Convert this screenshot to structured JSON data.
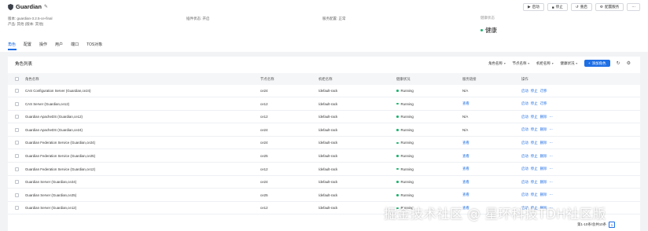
{
  "service": {
    "name": "Guardian",
    "version_label": "版本: guardian-3.2.5-ce-final",
    "product_label": "产品: 其他 (版本: 其他)",
    "plugin_status_label": "插件状态: 开启",
    "config_status_label": "服务配置: 正常",
    "health_label": "健康状态",
    "health_value": "健康"
  },
  "actions": [
    {
      "icon": "▶",
      "label": "启动",
      "name": "start"
    },
    {
      "icon": "■",
      "label": "停止",
      "name": "stop"
    },
    {
      "icon": "↺",
      "label": "重启",
      "name": "restart"
    },
    {
      "icon": "⚙",
      "label": "配置服务",
      "name": "configure"
    },
    {
      "icon": "⋯",
      "label": "",
      "name": "more"
    }
  ],
  "tabs": [
    "角色",
    "配置",
    "操作",
    "用户",
    "端口",
    "TOS对象"
  ],
  "roles": {
    "title": "角色列表",
    "filters": [
      "角色名称",
      "节点名称",
      "机柜名称",
      "健康状况"
    ],
    "add_label": "添加角色",
    "columns": [
      "角色名称",
      "节点名称",
      "机柜名称",
      "健康状况",
      "服务链接",
      "操作"
    ],
    "rows": [
      {
        "name": "CAS Configuration Server (Guardian,ce24)",
        "node": "ce24",
        "rack": "/default-rack",
        "health": "Running",
        "link": "N/A",
        "link_is_link": false,
        "ops": [
          "启动",
          "停止",
          "迁移"
        ],
        "more": ""
      },
      {
        "name": "CAS Server (Guardian,ce12)",
        "node": "ce12",
        "rack": "/default-rack",
        "health": "Running",
        "link": "查看",
        "link_is_link": true,
        "ops": [
          "启动",
          "停止",
          "迁移"
        ],
        "more": ""
      },
      {
        "name": "Guardian ApacheDS (Guardian,ce12)",
        "node": "ce12",
        "rack": "/default-rack",
        "health": "Running",
        "link": "N/A",
        "link_is_link": false,
        "ops": [
          "启动",
          "停止",
          "删除"
        ],
        "more": "⋯"
      },
      {
        "name": "Guardian ApacheDS (Guardian,ce24)",
        "node": "ce24",
        "rack": "/default-rack",
        "health": "Running",
        "link": "N/A",
        "link_is_link": false,
        "ops": [
          "启动",
          "停止",
          "删除"
        ],
        "more": "⋯"
      },
      {
        "name": "Guardian Federation Service (Guardian,ce24)",
        "node": "ce24",
        "rack": "/default-rack",
        "health": "Running",
        "link": "查看",
        "link_is_link": true,
        "ops": [
          "启动",
          "停止",
          "删除"
        ],
        "more": "⋯"
      },
      {
        "name": "Guardian Federation Service (Guardian,ce25)",
        "node": "ce25",
        "rack": "/default-rack",
        "health": "Running",
        "link": "查看",
        "link_is_link": true,
        "ops": [
          "启动",
          "停止",
          "删除"
        ],
        "more": "⋯"
      },
      {
        "name": "Guardian Federation Service (Guardian,ce12)",
        "node": "ce12",
        "rack": "/default-rack",
        "health": "Running",
        "link": "查看",
        "link_is_link": true,
        "ops": [
          "启动",
          "停止",
          "删除"
        ],
        "more": "⋯"
      },
      {
        "name": "Guardian Server (Guardian,ce24)",
        "node": "ce24",
        "rack": "/default-rack",
        "health": "Running",
        "link": "查看",
        "link_is_link": true,
        "ops": [
          "启动",
          "停止",
          "删除"
        ],
        "more": "⋯"
      },
      {
        "name": "Guardian Server (Guardian,ce25)",
        "node": "ce25",
        "rack": "/default-rack",
        "health": "Running",
        "link": "查看",
        "link_is_link": true,
        "ops": [
          "启动",
          "停止",
          "删除"
        ],
        "more": "⋯"
      },
      {
        "name": "Guardian Server (Guardian,ce12)",
        "node": "ce12",
        "rack": "/default-rack",
        "health": "Running",
        "link": "查看",
        "link_is_link": true,
        "ops": [
          "启动",
          "停止",
          "删除"
        ],
        "more": "⋯"
      }
    ],
    "pager_text": "第1-10条/总共10条",
    "page": "1"
  },
  "watermark": "掘金技术社区 @ 星环科技TDH社区版",
  "colors": {
    "accent": "#1f6fe5",
    "healthy": "#1cb46d"
  }
}
